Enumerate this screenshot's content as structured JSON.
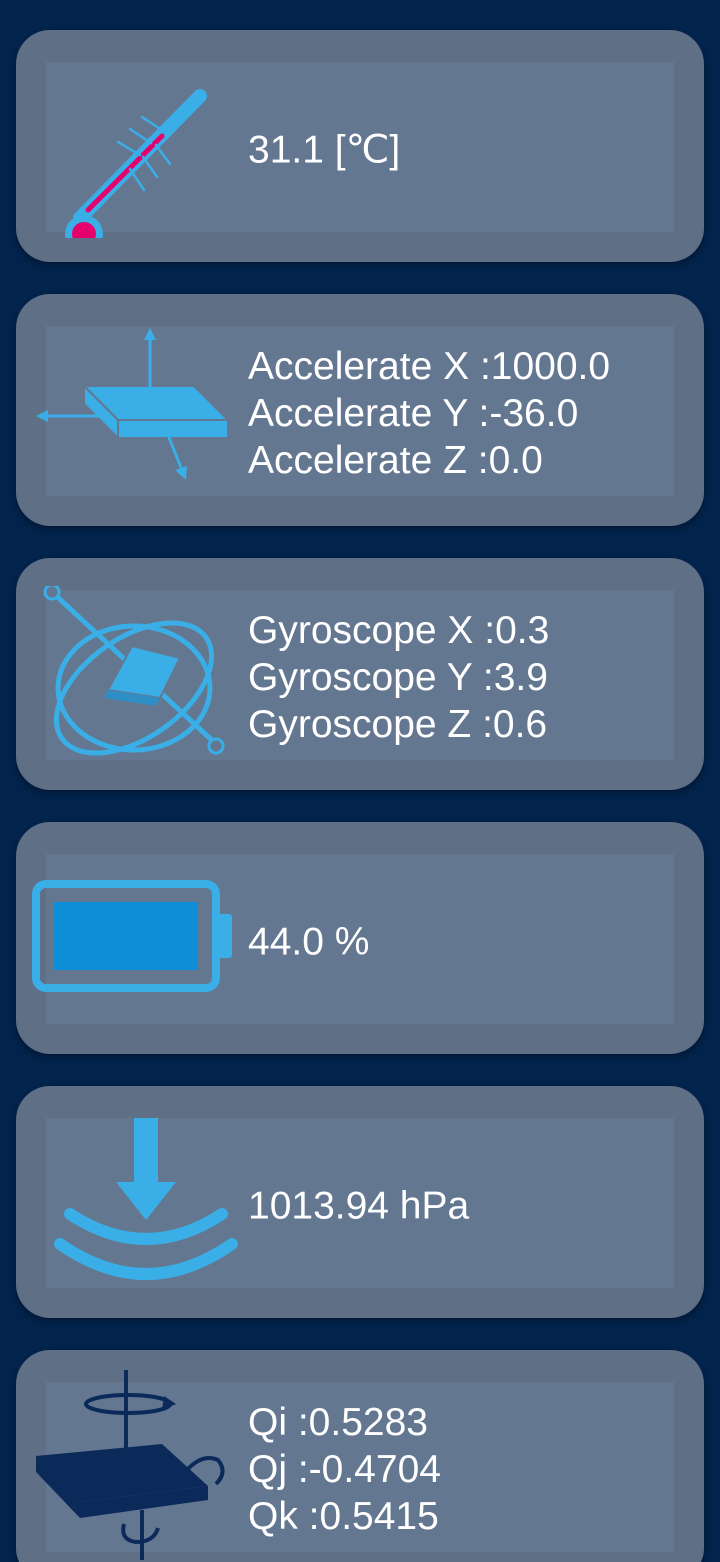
{
  "colors": {
    "background": "#02234c",
    "card": "#5f6f86",
    "card_inner": "#647791",
    "icon_blue": "#3aaee6",
    "thermo_red": "#e5006e",
    "battery_fill": "#0f8ed8",
    "quaternion_dark": "#0b2a5a",
    "text": "#ffffff"
  },
  "temperature": {
    "value": "31.1 [℃]",
    "icon": "thermometer-icon"
  },
  "accelerometer": {
    "icon": "accelerometer-icon",
    "x": "Accelerate X :1000.0",
    "y": "Accelerate Y :-36.0",
    "z": "Accelerate Z :0.0"
  },
  "gyroscope": {
    "icon": "gyroscope-icon",
    "x": "Gyroscope X :0.3",
    "y": "Gyroscope Y :3.9",
    "z": "Gyroscope Z :0.6"
  },
  "battery": {
    "icon": "battery-icon",
    "value": "44.0 %"
  },
  "pressure": {
    "icon": "pressure-icon",
    "value": "1013.94 hPa"
  },
  "quaternion": {
    "icon": "quaternion-icon",
    "qi": "Qi :0.5283",
    "qj": "Qj :-0.4704",
    "qk": "Qk :0.5415"
  }
}
